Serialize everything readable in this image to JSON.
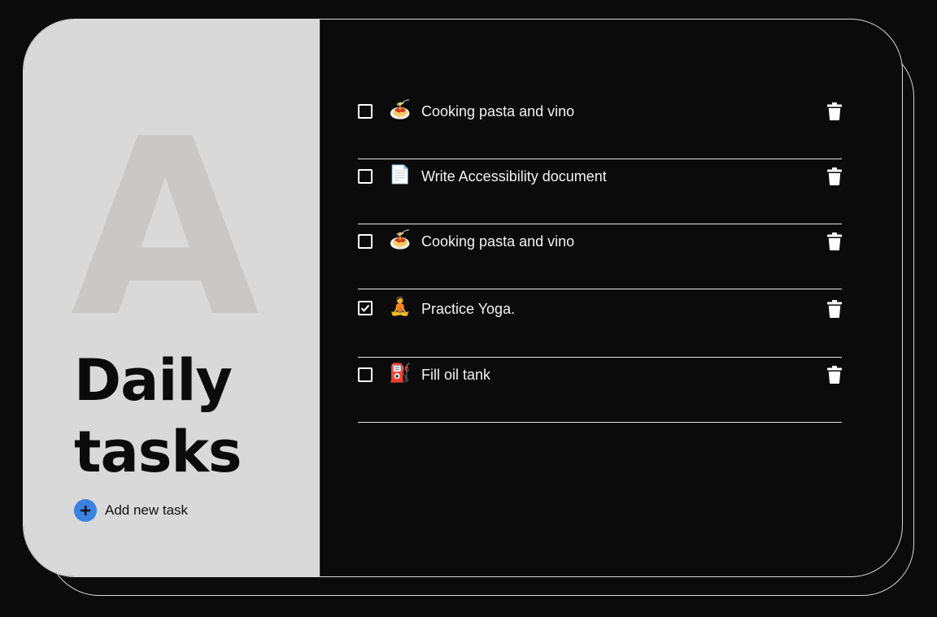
{
  "sidebar": {
    "big_letter": "A",
    "title": "Daily tasks",
    "add_task_label": "Add new task"
  },
  "tasks": [
    {
      "label": "Cooking pasta and vino",
      "icon": "spaghetti-icon",
      "emoji": "🍝",
      "checked": false
    },
    {
      "label": "Write Accessibility document",
      "icon": "document-icon",
      "emoji": "📄",
      "checked": false
    },
    {
      "label": "Cooking pasta and vino",
      "icon": "spaghetti-icon",
      "emoji": "🍝",
      "checked": false
    },
    {
      "label": "Practice Yoga.",
      "icon": "yoga-person-icon",
      "emoji": "🧘",
      "checked": true
    },
    {
      "label": "Fill oil tank",
      "icon": "fuel-can-icon",
      "emoji": "⛽",
      "checked": false
    }
  ],
  "colors": {
    "background": "#0b0b0b",
    "sidebar": "#d9d9d9",
    "accent": "#3b82e0",
    "text_light": "#f2f2f2"
  }
}
